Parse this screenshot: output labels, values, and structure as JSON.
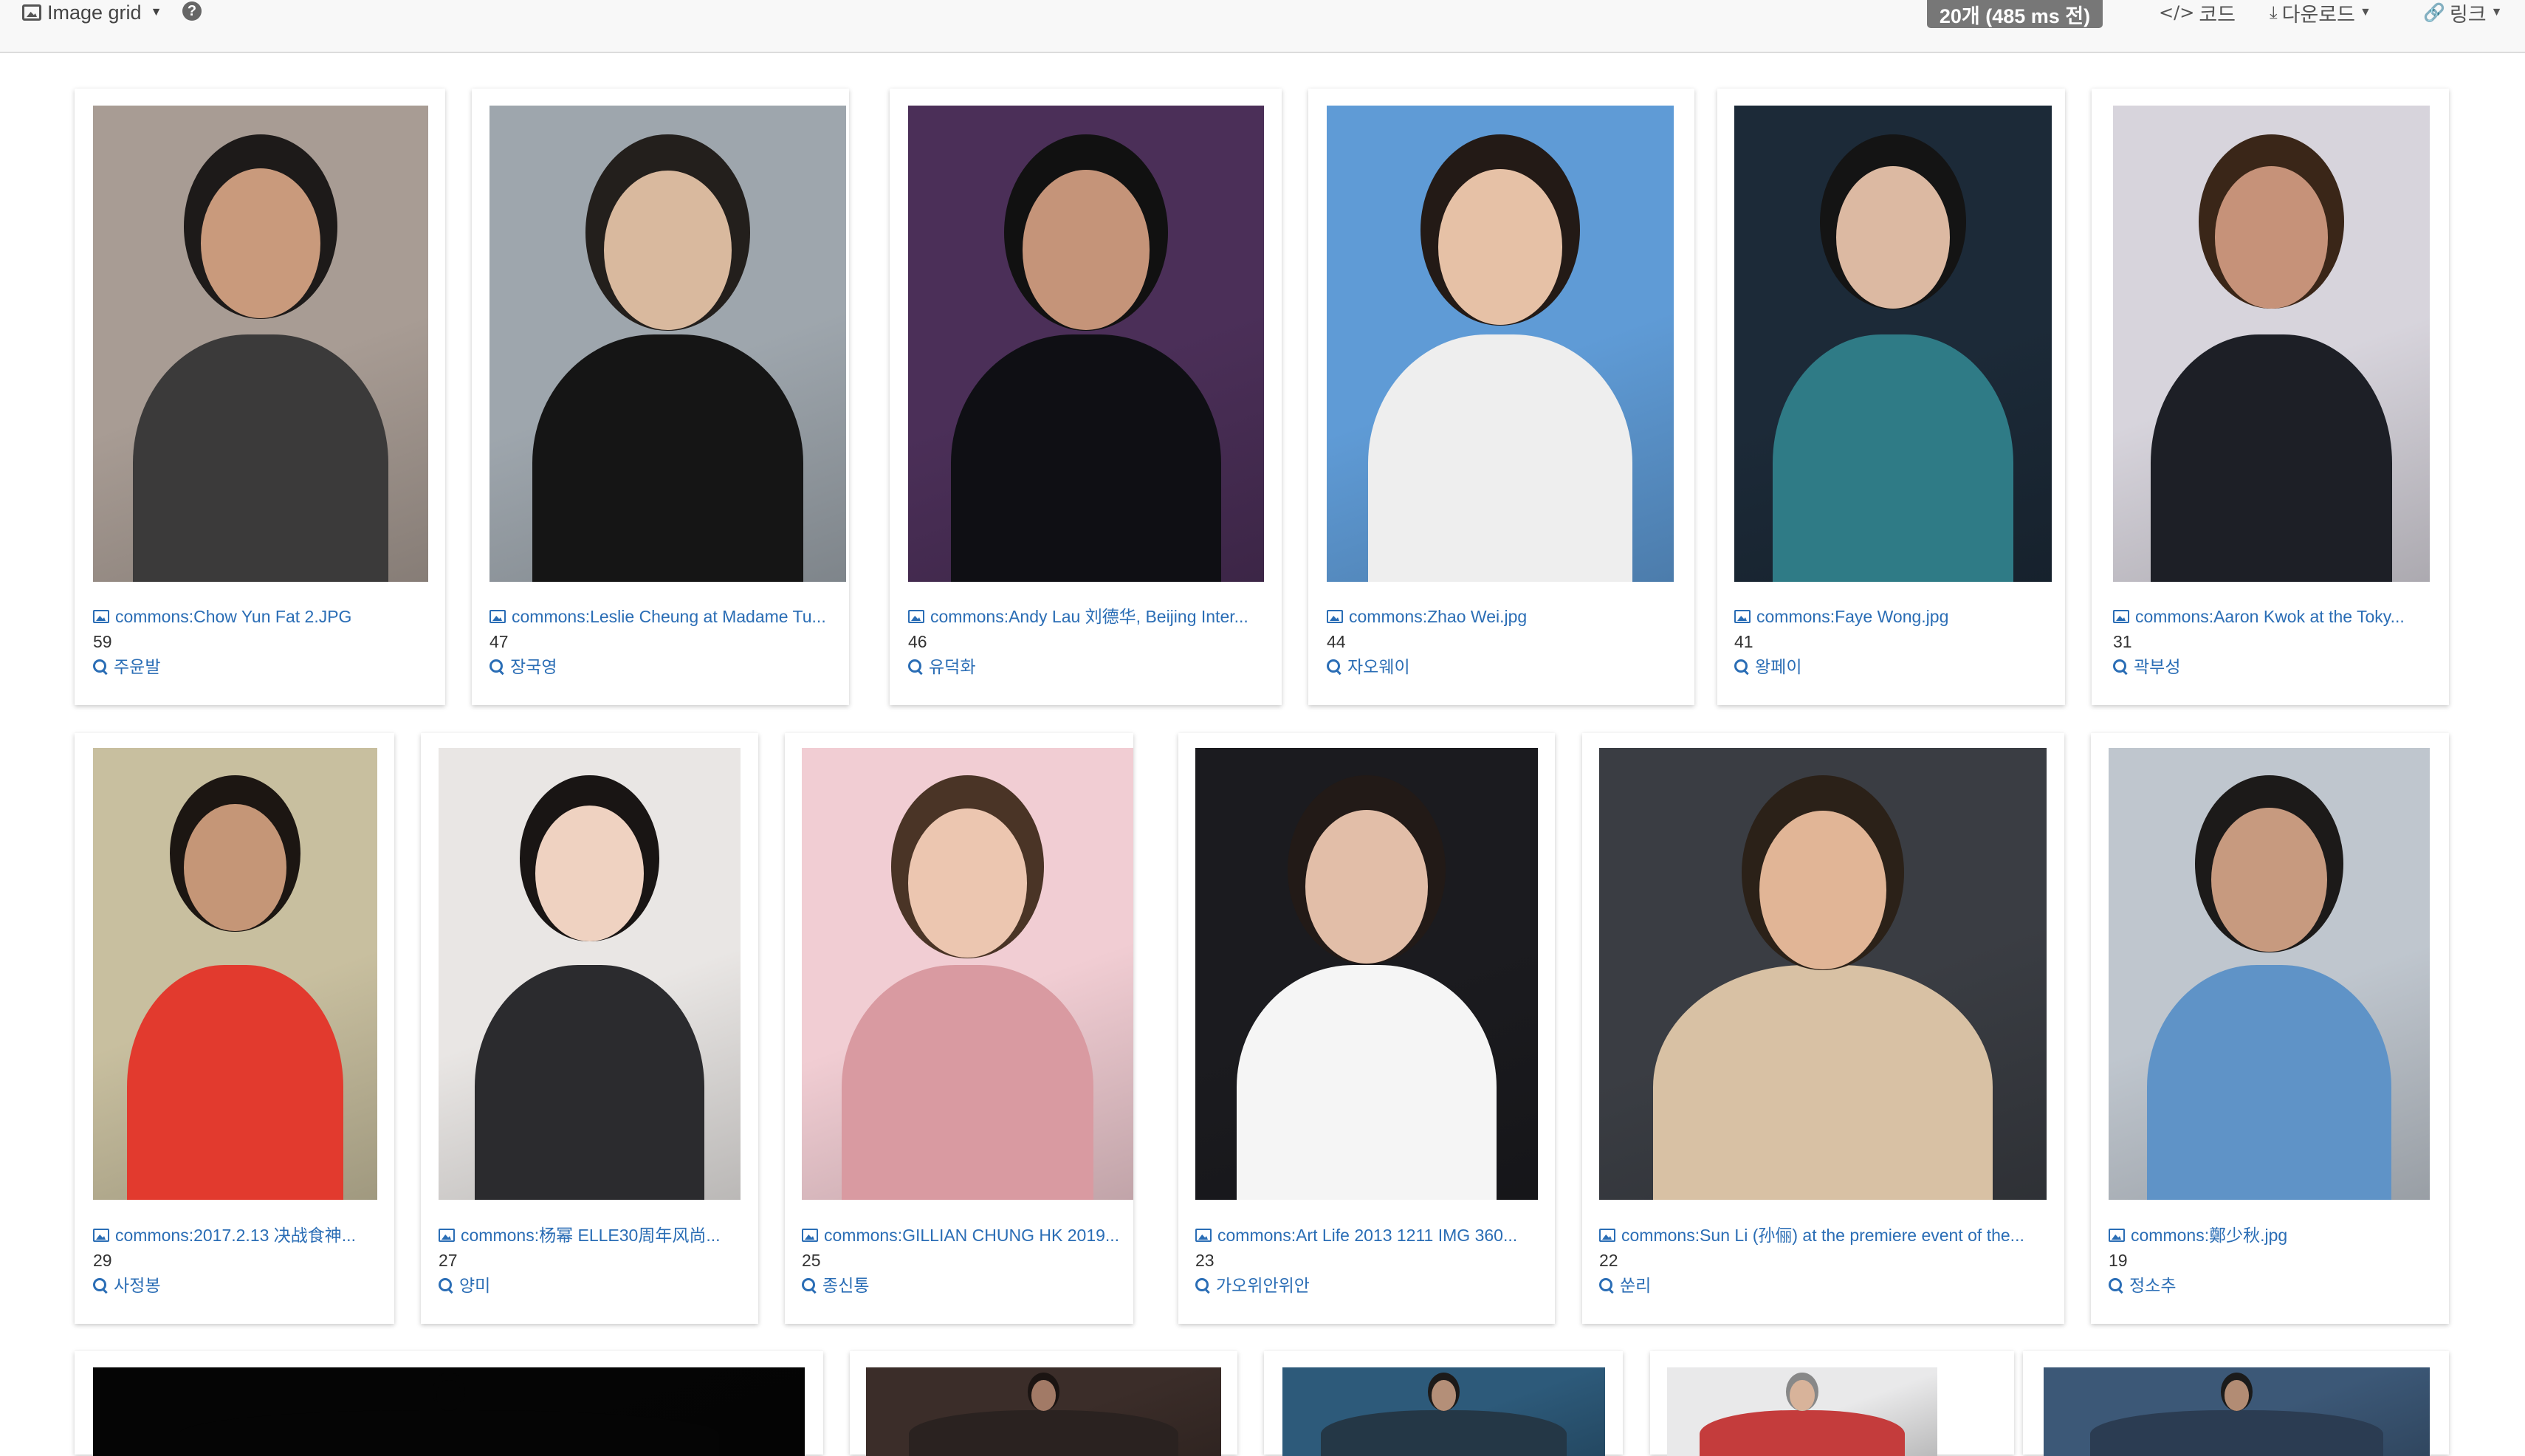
{
  "toolbar": {
    "view_label": "Image grid",
    "help_icon": "question-circle-icon",
    "stats_badge": "20개 (485 ms 전)",
    "code_label": "코드",
    "download_label": "다운로드",
    "link_label": "링크"
  },
  "colors": {
    "link": "#2a6db5",
    "badge": "#777777",
    "toolbar_bg": "#f8f8f8"
  },
  "rows": [
    {
      "items": [
        {
          "title": "commons:Chow Yun Fat 2.JPG",
          "count": "59",
          "query": "주윤발",
          "palette": {
            "bg": "#a89c94",
            "skin": "#c99a7c",
            "hair": "#1d1a19",
            "cloth": "#3b3a3a"
          }
        },
        {
          "title": "commons:Leslie Cheung at Madame Tu...",
          "count": "47",
          "query": "장국영",
          "palette": {
            "bg": "#9ea6ad",
            "skin": "#d9b99e",
            "hair": "#231f1c",
            "cloth": "#151515"
          }
        },
        {
          "title": "commons:Andy Lau 刘德华, Beijing Inter...",
          "count": "46",
          "query": "유덕화",
          "palette": {
            "bg": "#4b2f58",
            "skin": "#c59479",
            "hair": "#111111",
            "cloth": "#0f0f14"
          }
        },
        {
          "title": "commons:Zhao Wei.jpg",
          "count": "44",
          "query": "자오웨이",
          "palette": {
            "bg": "#5f9bd6",
            "skin": "#e6c1a6",
            "hair": "#231a16",
            "cloth": "#eeeeee"
          }
        },
        {
          "title": "commons:Faye Wong.jpg",
          "count": "41",
          "query": "왕페이",
          "palette": {
            "bg": "#1c2a38",
            "skin": "#dcb9a2",
            "hair": "#141414",
            "cloth": "#2f7b86"
          }
        },
        {
          "title": "commons:Aaron Kwok at the Toky...",
          "count": "31",
          "query": "곽부성",
          "palette": {
            "bg": "#d7d4dc",
            "skin": "#c69279",
            "hair": "#3a2618",
            "cloth": "#1d1f26"
          }
        }
      ]
    },
    {
      "items": [
        {
          "title": "commons:2017.2.13 决战食神...",
          "count": "29",
          "query": "사정봉",
          "palette": {
            "bg": "#c8bf9f",
            "skin": "#c59677",
            "hair": "#1c1612",
            "cloth": "#e23a2e"
          }
        },
        {
          "title": "commons:杨幂 ELLE30周年风尚...",
          "count": "27",
          "query": "양미",
          "palette": {
            "bg": "#e9e6e4",
            "skin": "#efd2c1",
            "hair": "#191514",
            "cloth": "#2b2b2e"
          }
        },
        {
          "title": "commons:GILLIAN CHUNG HK 2019...",
          "count": "25",
          "query": "종신통",
          "palette": {
            "bg": "#f1cdd3",
            "skin": "#ecc6b0",
            "hair": "#4a3426",
            "cloth": "#d99aa1"
          }
        },
        {
          "title": "commons:Art Life 2013 1211 IMG 360...",
          "count": "23",
          "query": "가오위안위안",
          "palette": {
            "bg": "#1b1b1f",
            "skin": "#e2bea8",
            "hair": "#221a17",
            "cloth": "#f5f5f5"
          }
        },
        {
          "title": "commons:Sun Li (孙俪) at the premiere event of the...",
          "count": "22",
          "query": "쑨리",
          "palette": {
            "bg": "#3a3d43",
            "skin": "#e1b596",
            "hair": "#2b2118",
            "cloth": "#d8c1a4"
          }
        },
        {
          "title": "commons:鄭少秋.jpg",
          "count": "19",
          "query": "정소추",
          "palette": {
            "bg": "#bfc6ce",
            "skin": "#c79a7f",
            "hair": "#1c1a19",
            "cloth": "#5f93c7"
          }
        }
      ]
    },
    {
      "items": [
        {
          "palette": {
            "bg": "#050505",
            "skin": "#050505",
            "hair": "#050505",
            "cloth": "#050505"
          }
        },
        {
          "palette": {
            "bg": "#3b2d29",
            "skin": "#a27a66",
            "hair": "#1b1412",
            "cloth": "#2a2220"
          }
        },
        {
          "palette": {
            "bg": "#2d5a7a",
            "skin": "#b48f78",
            "hair": "#1c1a19",
            "cloth": "#243746"
          }
        },
        {
          "palette": {
            "bg": "#e9e9ea",
            "skin": "#d8b39a",
            "hair": "#888888",
            "cloth": "#c43c3c"
          }
        },
        {
          "palette": {
            "bg": "#3c5877",
            "skin": "#b28c74",
            "hair": "#1b1b1b",
            "cloth": "#2b3c52"
          }
        }
      ]
    }
  ]
}
